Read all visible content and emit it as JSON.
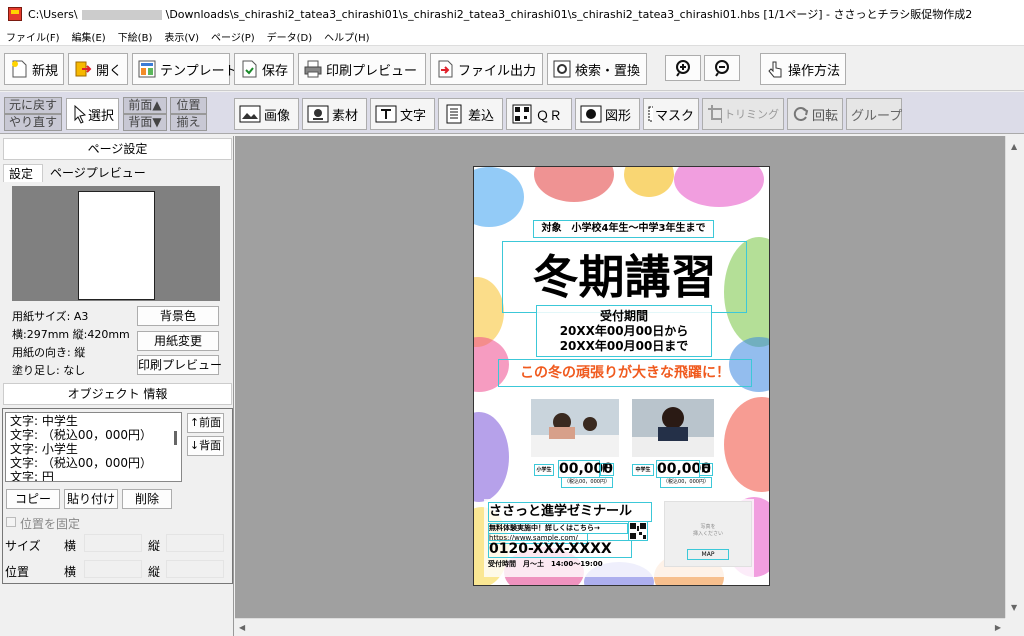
{
  "titlebar": {
    "path_prefix": "C:\\Users\\",
    "path_rest": "\\Downloads\\s_chirashi2_tatea3_chirashi01\\s_chirashi2_tatea3_chirashi01\\s_chirashi2_tatea3_chirashi01.hbs",
    "page_info": "[1/1ページ]",
    "app_title": "- ささっとチラシ販促物作成2"
  },
  "menu": [
    "ファイル(F)",
    "編集(E)",
    "下絵(B)",
    "表示(V)",
    "ページ(P)",
    "データ(D)",
    "ヘルプ(H)"
  ],
  "toolbar": {
    "new": "新規",
    "open": "開く",
    "template": "テンプレート",
    "save": "保存",
    "print_preview": "印刷プレビュー",
    "export": "ファイル出力",
    "search_replace": "検索・置換",
    "how_to": "操作方法"
  },
  "toolbar2": {
    "undo": "元に戻す",
    "redo": "やり直す",
    "select": "選択",
    "front": "前面▲",
    "back": "背面▼",
    "align1": "位置",
    "align2": "揃え",
    "image": "画像",
    "material": "素材",
    "text": "文字",
    "insert": "差込",
    "qr": "ＱＲ",
    "shape": "図形",
    "mask": "マスク",
    "trim": "トリミング",
    "rotate": "回転",
    "group": "グループ"
  },
  "page_settings": {
    "header": "ページ設定",
    "tab_settings": "設定",
    "tab_preview": "ページプレビュー",
    "paper_size": "用紙サイズ: A3",
    "dimensions": "横:297mm 縦:420mm",
    "orientation": "用紙の向き: 縦",
    "bleed": "塗り足し: なし",
    "bg_color_btn": "背景色",
    "change_paper_btn": "用紙変更",
    "print_preview_btn": "印刷プレビュー"
  },
  "object_info": {
    "header": "オブジェクト 情報",
    "items": [
      "文字: 中学生",
      "文字: （税込00，000円）",
      "文字: 小学生",
      "文字: （税込00，000円）",
      "文字: 円"
    ],
    "front_btn": "↑前面",
    "back_btn": "↓背面",
    "copy_btn": "コピー",
    "paste_btn": "貼り付け",
    "delete_btn": "削除",
    "lock_label": "位置を固定",
    "size_label": "サイズ",
    "pos_label": "位置",
    "horiz": "横",
    "vert": "縦"
  },
  "flyer": {
    "target": "対象　小学校4年生～中学3年生まで",
    "title": "冬期講習",
    "period_label": "受付期間",
    "period_from": "20XX年00月00日から",
    "period_to": "20XX年00月00日まで",
    "catch": "この冬の頑張りが大きな飛躍に！",
    "elem_label": "小学生",
    "elem_price": "00,000",
    "yen": "円",
    "elem_tax": "（税込00，000円）",
    "jr_label": "中学生",
    "jr_price": "00,000",
    "jr_tax": "（税込00，000円）",
    "school": "ささっと進学ゼミナール",
    "trial": "無料体験実施中！詳しくはこちら→",
    "url": "https://www.sample.com/",
    "phone": "0120-XXX-XXXX",
    "hours": "受付時間　月～土　14:00～19:00",
    "photo_placeholder_1": "写真を",
    "photo_placeholder_2": "挿入ください",
    "map": "MAP"
  },
  "colors": {
    "catch_orange": "#f05a1e",
    "selection_cyan": "#3cc8d8",
    "canvas_gray": "#a0a0a0"
  }
}
